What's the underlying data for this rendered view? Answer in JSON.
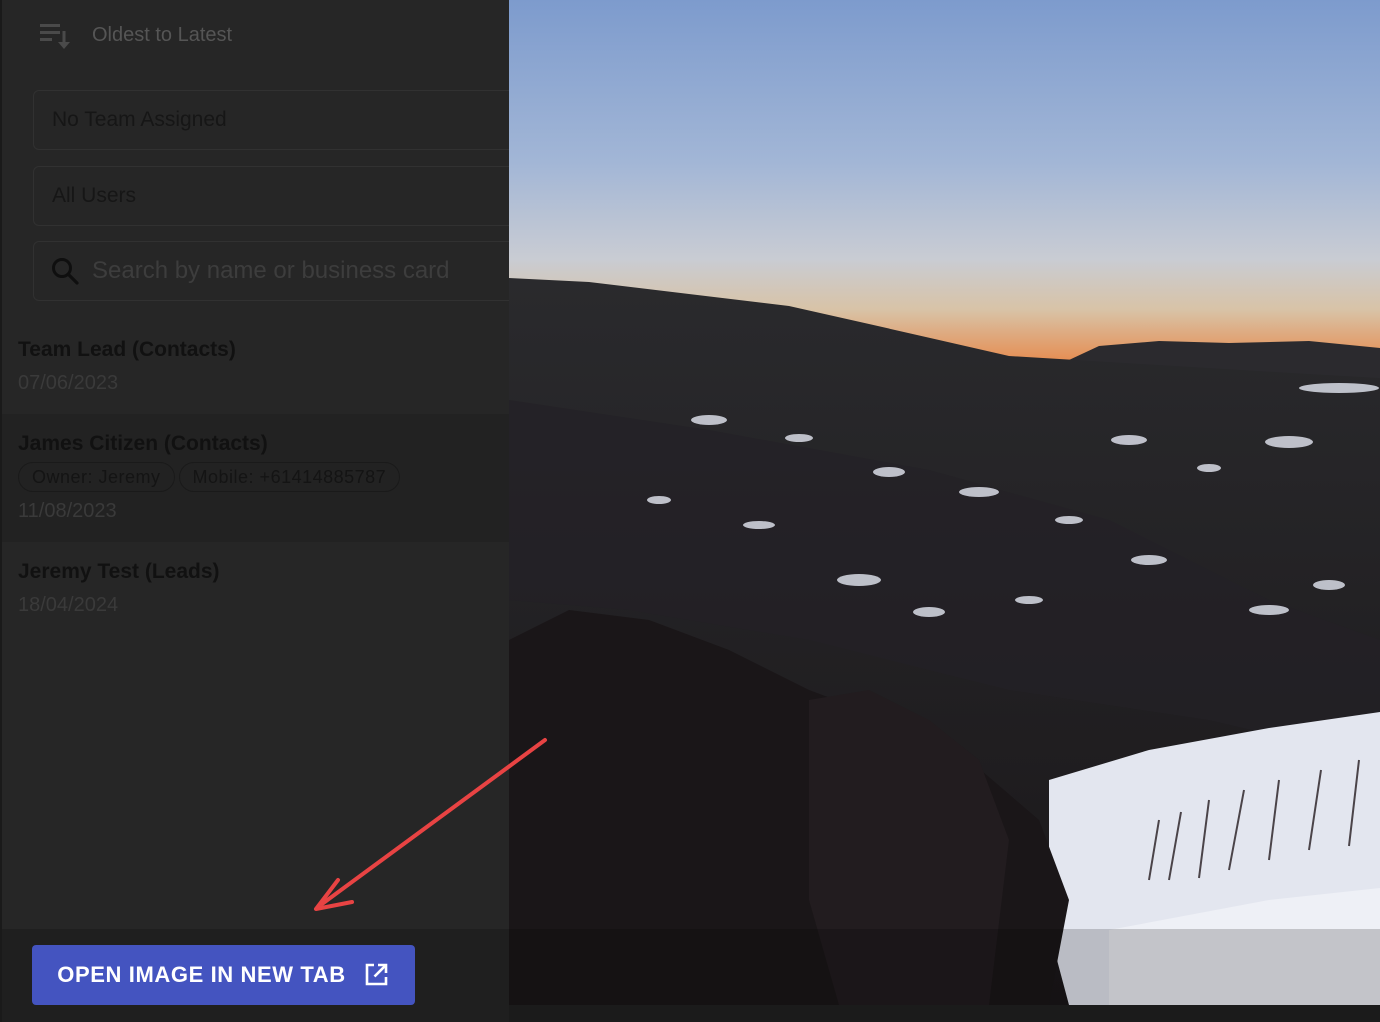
{
  "sort": {
    "label": "Oldest to Latest",
    "icon": "sort-icon"
  },
  "filters": {
    "team": "No Team Assigned",
    "users": "All Users"
  },
  "search": {
    "placeholder": "Search by name or business card",
    "icon": "search-icon"
  },
  "contacts": [
    {
      "name": "Team Lead (Contacts)",
      "date": "07/06/2023"
    },
    {
      "name": "James Citizen (Contacts)",
      "chips": [
        "Owner: Jeremy",
        "Mobile: +61414885787"
      ],
      "date": "11/08/2023"
    },
    {
      "name": "Jeremy Test (Leads)",
      "date": "18/04/2024"
    }
  ],
  "open_button": {
    "label": "OPEN IMAGE IN NEW TAB",
    "icon": "open-in-new-icon"
  },
  "colors": {
    "button": "#4454c0",
    "annotation_arrow": "#e84343",
    "panel": "#262626"
  }
}
